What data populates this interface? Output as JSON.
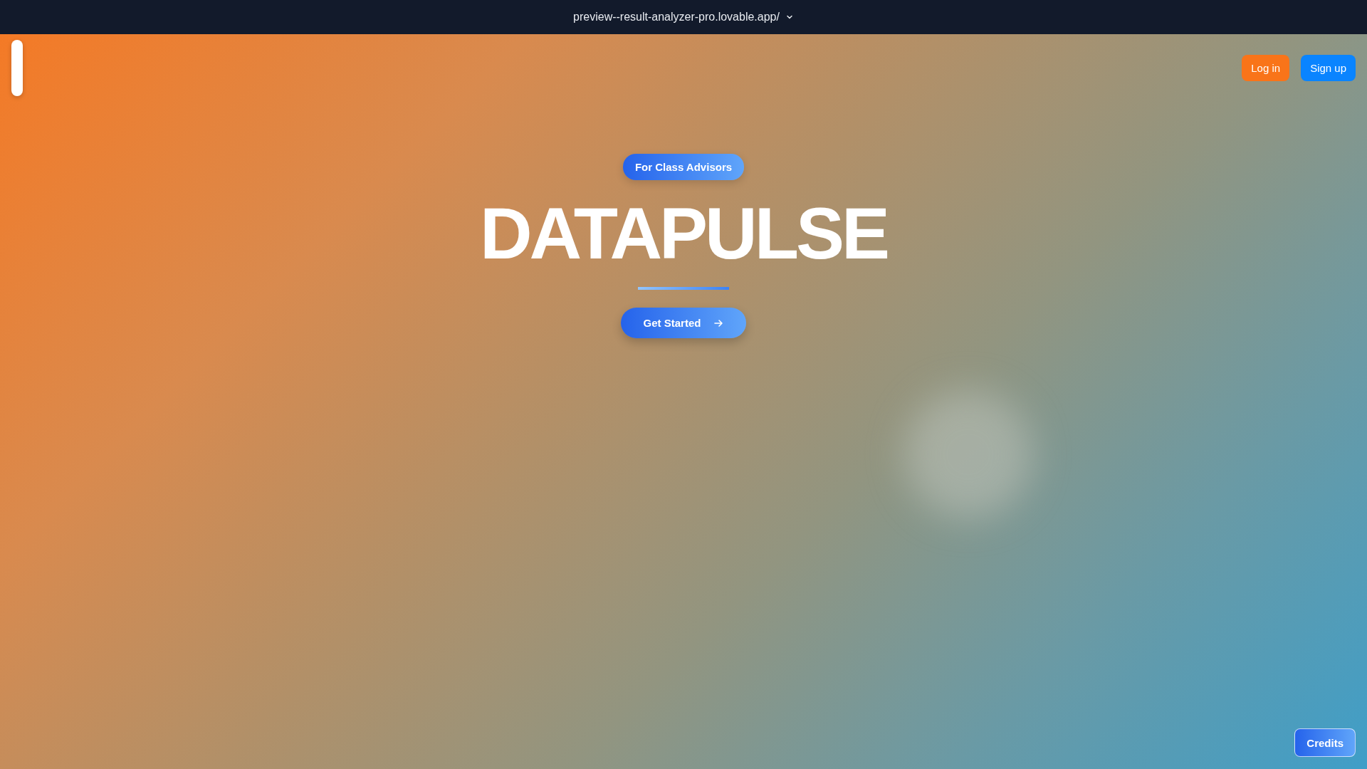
{
  "address_bar": {
    "url": "preview--result-analyzer-pro.lovable.app/"
  },
  "header": {
    "buttons": [
      {
        "label": "Log in",
        "kind": "secondary"
      },
      {
        "label": "Sign up",
        "kind": "primary"
      }
    ]
  },
  "hero": {
    "badge": "For Class Advisors",
    "title": "DATAPULSE",
    "cta": "Get Started"
  },
  "credits_button": "Credits"
}
